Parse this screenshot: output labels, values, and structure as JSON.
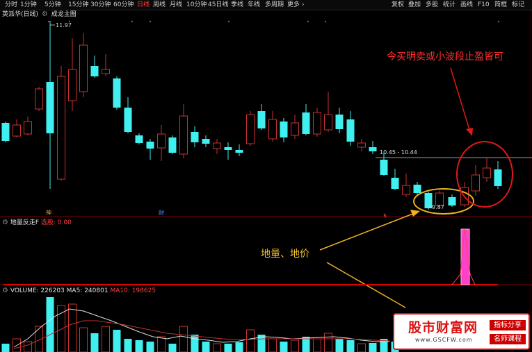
{
  "toolbar": {
    "left": [
      "分时",
      "1分钟",
      "5分钟",
      "15分钟",
      "30分钟",
      "60分钟",
      "日线",
      "周线",
      "月线",
      "10分钟",
      "45日线",
      "季线",
      "年线",
      "多周期",
      "更多 ›"
    ],
    "active": "日线",
    "right": [
      "复权",
      "叠加",
      "多股",
      "统计",
      "画线",
      "F10",
      "简框",
      "标记"
    ]
  },
  "stock": {
    "name": "英派华(日线)",
    "indicator": "成龙主图"
  },
  "price": {
    "high_label": "11.97",
    "low_label": "9.87",
    "range_label": "10.45 - 10.44"
  },
  "markers": {
    "m1": "神",
    "m2": "财",
    "m3": "$"
  },
  "sub_indicator": {
    "name": "地量反走F",
    "value_label": "选股: 0.00"
  },
  "volume": {
    "label": "VOLUME: 226203",
    "ma5": "MA5: 240801",
    "ma10": "MA10: 198625"
  },
  "annotations": {
    "top": "今买明卖或小波段止盈皆可",
    "mid": "地量、地价"
  },
  "watermark": {
    "title": "股市财富网",
    "url": "www.GSCFW.com",
    "tag1": "指标分享",
    "tag2": "名师课程"
  },
  "colors": {
    "up": "#c83232",
    "down": "#40f0f0",
    "accent_red": "#ff3030",
    "annotation": "#f0c030",
    "pink": "#ff40c8"
  }
}
